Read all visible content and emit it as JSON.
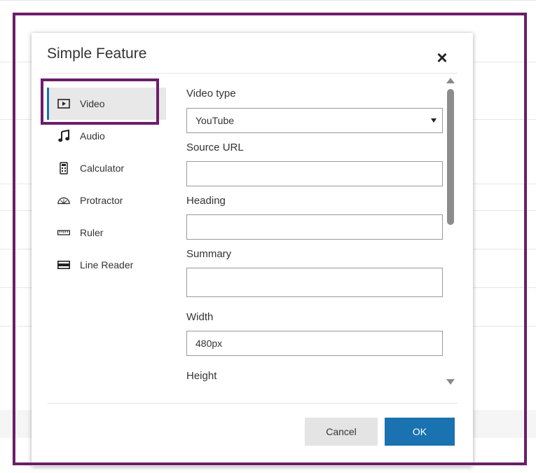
{
  "dialog": {
    "title": "Simple Feature",
    "close_icon": "close-icon"
  },
  "tools": [
    {
      "label": "Video",
      "icon": "video-icon",
      "selected": true
    },
    {
      "label": "Audio",
      "icon": "music-note-icon",
      "selected": false
    },
    {
      "label": "Calculator",
      "icon": "calculator-icon",
      "selected": false
    },
    {
      "label": "Protractor",
      "icon": "protractor-icon",
      "selected": false
    },
    {
      "label": "Ruler",
      "icon": "ruler-icon",
      "selected": false
    },
    {
      "label": "Line Reader",
      "icon": "line-reader-icon",
      "selected": false
    }
  ],
  "form": {
    "video_type": {
      "label": "Video type",
      "value": "YouTube"
    },
    "source_url": {
      "label": "Source URL",
      "value": ""
    },
    "heading": {
      "label": "Heading",
      "value": ""
    },
    "summary": {
      "label": "Summary",
      "value": ""
    },
    "width": {
      "label": "Width",
      "value": "480px"
    },
    "height": {
      "label": "Height"
    }
  },
  "buttons": {
    "cancel": "Cancel",
    "ok": "OK"
  },
  "colors": {
    "accent": "#1a72b0",
    "highlight_frame": "#6b1e6b",
    "selected_bg": "#e8e8e8"
  }
}
